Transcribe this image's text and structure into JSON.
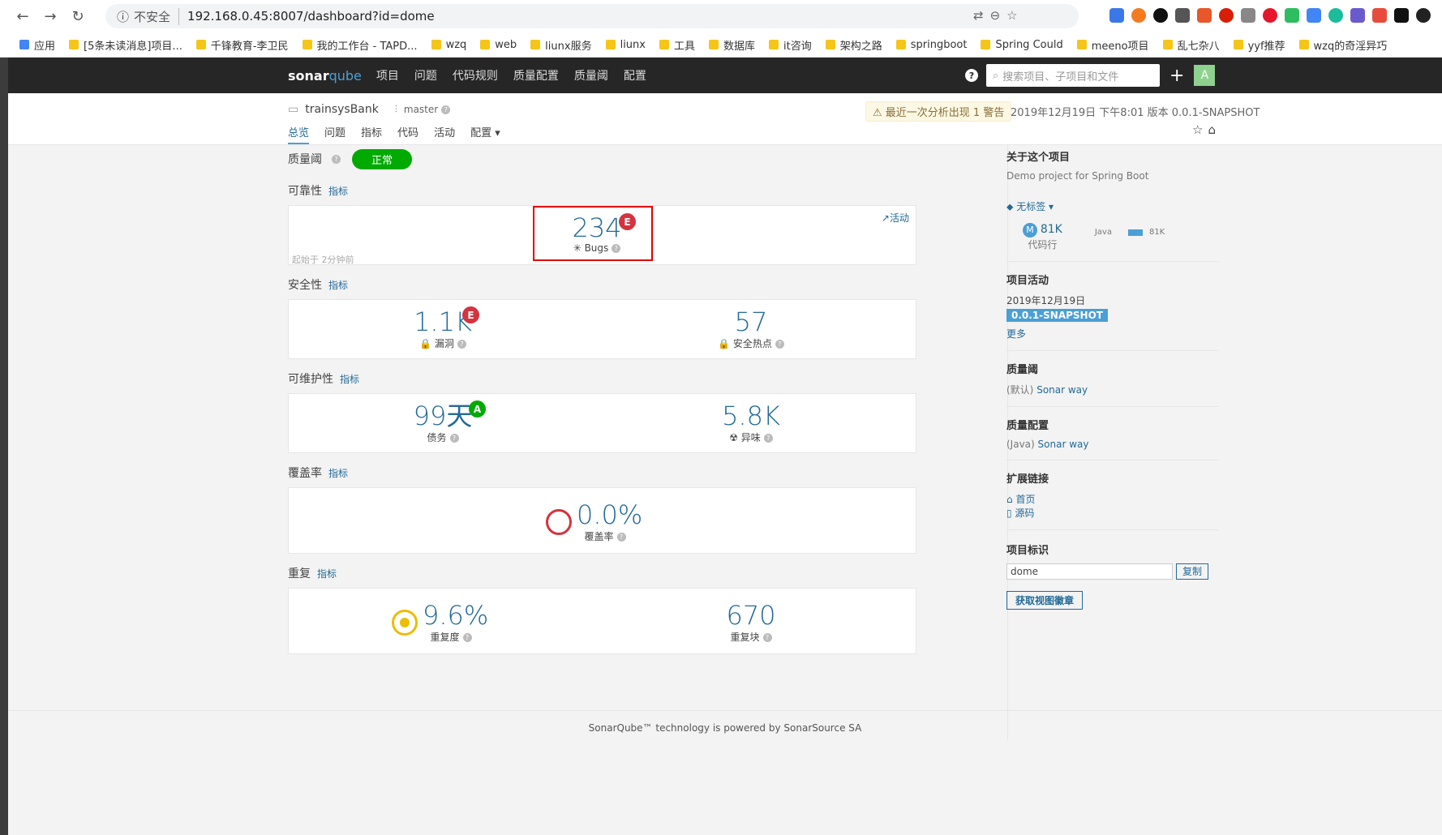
{
  "browser": {
    "insecure": "不安全",
    "url": "192.168.0.45:8007/dashboard?id=dome",
    "bookmarks": [
      "应用",
      "[5条未读消息]项目...",
      "千锋教育-李卫民",
      "我的工作台 - TAPD...",
      "wzq",
      "web",
      "liunx服务",
      "liunx",
      "工具",
      "数据库",
      "it咨询",
      "架构之路",
      "springboot",
      "Spring Could",
      "meeno项目",
      "乱七杂八",
      "yyf推荐",
      "wzq的奇淫异巧"
    ]
  },
  "topnav": {
    "logo_a": "sonar",
    "logo_b": "qube",
    "items": [
      "项目",
      "问题",
      "代码规则",
      "质量配置",
      "质量阈",
      "配置"
    ],
    "search_placeholder": "搜索项目、子项目和文件",
    "avatar": "A"
  },
  "project": {
    "name": "trainsysBank",
    "branch": "master",
    "warning": "最近一次分析出现 1 警告",
    "meta": "2019年12月19日 下午8:01  版本 0.0.1-SNAPSHOT",
    "tabs": [
      "总览",
      "问题",
      "指标",
      "代码",
      "活动",
      "配置"
    ]
  },
  "quality_gate": {
    "label": "质量阈",
    "status": "正常"
  },
  "sections": {
    "reliability": {
      "title": "可靠性",
      "link": "指标",
      "value": "234",
      "sub": "Bugs",
      "rating": "E",
      "activity": "活动",
      "since": "起始于 2分钟前"
    },
    "security": {
      "title": "安全性",
      "link": "指标",
      "vuln_value": "1.1K",
      "vuln_sub": "漏洞",
      "vuln_rating": "E",
      "hotspot_value": "57",
      "hotspot_sub": "安全热点"
    },
    "maintainability": {
      "title": "可维护性",
      "link": "指标",
      "debt_value": "99天",
      "debt_sub": "债务",
      "debt_rating": "A",
      "smell_value": "5.8K",
      "smell_sub": "异味"
    },
    "coverage": {
      "title": "覆盖率",
      "link": "指标",
      "value": "0.0%",
      "sub": "覆盖率"
    },
    "duplications": {
      "title": "重复",
      "link": "指标",
      "dup_value": "9.6%",
      "dup_sub": "重复度",
      "blocks_value": "670",
      "blocks_sub": "重复块"
    }
  },
  "sidebar": {
    "about_title": "关于这个项目",
    "about_desc": "Demo project for Spring Boot",
    "tags": "无标签",
    "lines_badge": "M",
    "lines_value": "81K",
    "lines_label": "代码行",
    "lang": "Java",
    "lang_value": "81K",
    "activity_title": "项目活动",
    "activity_date": "2019年12月19日",
    "activity_version": "0.0.1-SNAPSHOT",
    "more": "更多",
    "qg_title": "质量阈",
    "qg_default": "(默认)",
    "qg_link": "Sonar way",
    "qp_title": "质量配置",
    "qp_lang": "(Java)",
    "qp_link": "Sonar way",
    "ext_title": "扩展链接",
    "ext_home": "首页",
    "ext_source": "源码",
    "key_title": "项目标识",
    "key_value": "dome",
    "copy": "复制",
    "badge_btn": "获取视图徽章"
  },
  "footer": {
    "line1": "SonarQube™ technology is powered by SonarSource SA"
  }
}
